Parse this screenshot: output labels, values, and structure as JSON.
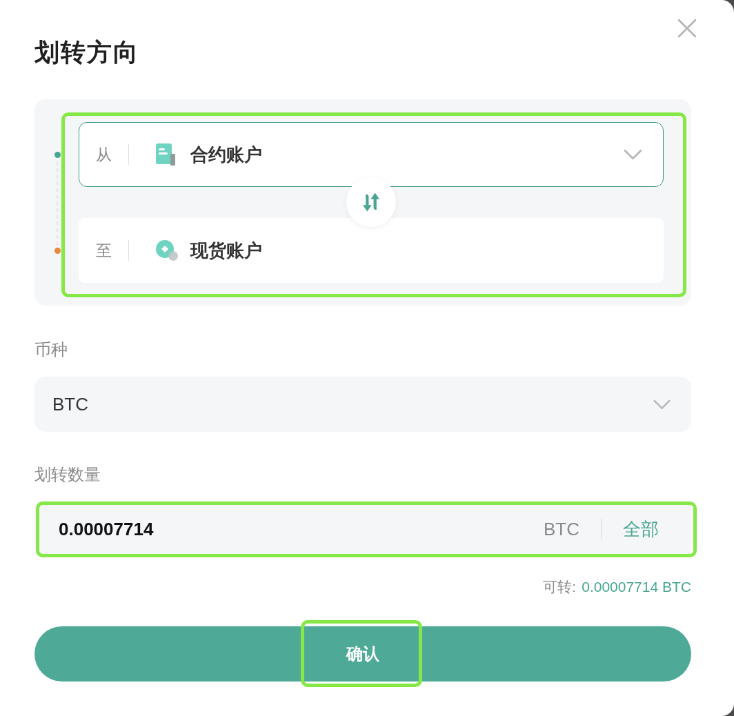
{
  "dialog": {
    "title": "划转方向"
  },
  "transfer": {
    "highlighted": true,
    "accounts": [
      {
        "kind": "contract",
        "direction": "从",
        "name": "合约账户",
        "color": "#4aa592",
        "selected": true,
        "dropdown": true
      },
      {
        "kind": "spot",
        "direction": "至",
        "name": "现货账户",
        "color": "#e8893c",
        "selected": false,
        "dropdown": false
      }
    ]
  },
  "currency": {
    "label": "币种",
    "value": "BTC"
  },
  "amount": {
    "label": "划转数量",
    "value": "0.00007714",
    "unit": "BTC",
    "max_label": "全部",
    "highlighted": true
  },
  "available": {
    "label": "可转:",
    "value": "0.00007714 BTC"
  },
  "confirm_button": {
    "label": "确认",
    "highlighted": true
  }
}
